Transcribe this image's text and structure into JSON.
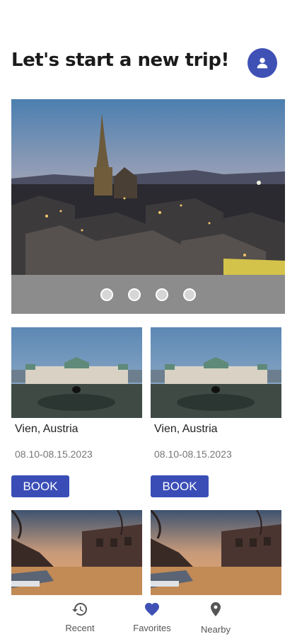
{
  "header": {
    "title": "Let's start a new trip!",
    "avatar_icon": "person-icon"
  },
  "hero": {
    "image": "city-skyline-dusk",
    "slide_count": 4,
    "active_slide": 1
  },
  "cards": [
    {
      "title": "Vien, Austria",
      "date": "08.10-08.15.2023",
      "button": "BOOK"
    },
    {
      "title": "Vien, Austria",
      "date": "08.10-08.15.2023",
      "button": "BOOK"
    }
  ],
  "nav": {
    "items": [
      {
        "label": "Recent",
        "icon": "history-icon"
      },
      {
        "label": "Favorites",
        "icon": "heart-icon",
        "active": true
      },
      {
        "label": "Nearby",
        "icon": "location-pin-icon"
      }
    ]
  },
  "colors": {
    "accent": "#3f51b5",
    "button": "#3a4db7",
    "carousel_bar": "#8c8c8c"
  }
}
